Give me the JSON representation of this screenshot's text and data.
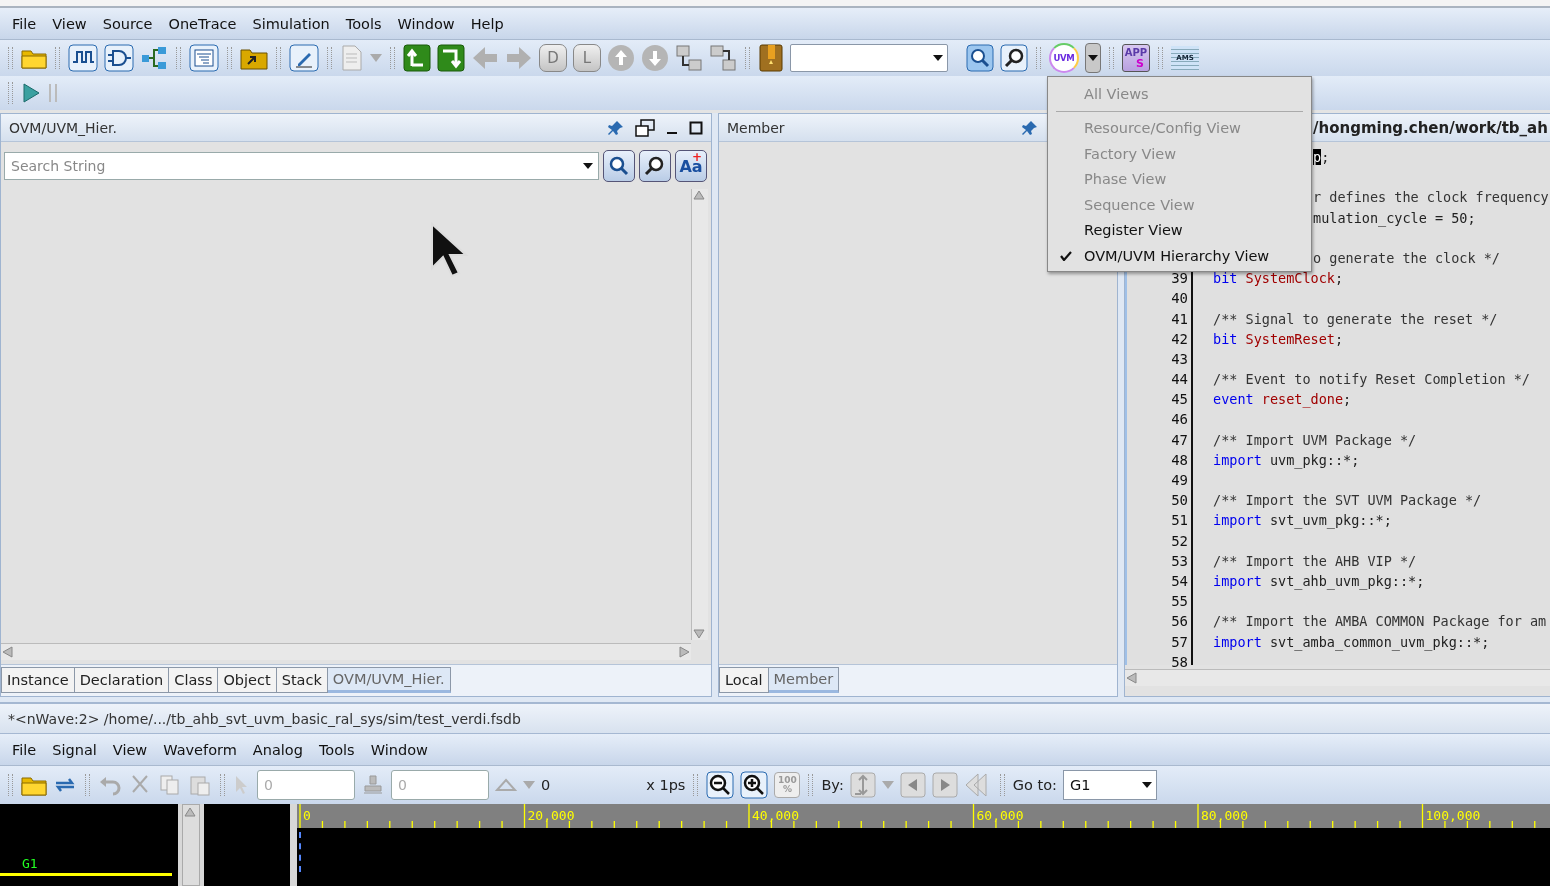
{
  "menubar": [
    {
      "label": "File"
    },
    {
      "label": "View"
    },
    {
      "label": "Source"
    },
    {
      "label": "OneTrace"
    },
    {
      "label": "Simulation"
    },
    {
      "label": "Tools"
    },
    {
      "label": "Window"
    },
    {
      "label": "Help"
    }
  ],
  "toolbar": {
    "letter_buttons": [
      "D",
      "L"
    ],
    "uvm_badge": "UVM",
    "apps_badge": [
      "APP",
      "S"
    ],
    "ams_badge": "AMS"
  },
  "view_menu": {
    "items": [
      {
        "kind": "item",
        "label": "All Views",
        "disabled": true,
        "checked": false
      },
      {
        "kind": "separator"
      },
      {
        "kind": "item",
        "label": "Resource/Config View",
        "disabled": true,
        "checked": false
      },
      {
        "kind": "item",
        "label": "Factory View",
        "disabled": true,
        "checked": false
      },
      {
        "kind": "item",
        "label": "Phase View",
        "disabled": true,
        "checked": false
      },
      {
        "kind": "item",
        "label": "Sequence View",
        "disabled": true,
        "checked": false
      },
      {
        "kind": "item",
        "label": "Register View",
        "disabled": false,
        "checked": false
      },
      {
        "kind": "item",
        "label": "OVM/UVM Hierarchy View",
        "disabled": false,
        "checked": true
      }
    ]
  },
  "hierarchy_pane": {
    "title": "OVM/UVM_Hier.",
    "search": {
      "placeholder": "Search String"
    },
    "case_button": {
      "label": "Aa",
      "badge": "+"
    },
    "tabs": [
      {
        "label": "Instance",
        "selected": false
      },
      {
        "label": "Declaration",
        "selected": false
      },
      {
        "label": "Class",
        "selected": false
      },
      {
        "label": "Object",
        "selected": false
      },
      {
        "label": "Stack",
        "selected": false
      },
      {
        "label": "OVM/UVM_Hier.",
        "selected": true
      }
    ]
  },
  "member_pane": {
    "title": "Member",
    "tabs": [
      {
        "label": "Local",
        "selected": false
      },
      {
        "label": "Member",
        "selected": true
      }
    ]
  },
  "source_pane": {
    "title": "/hongming.chen/work/tb_ah",
    "lines": [
      {
        "kind": "clipped",
        "segments": [
          {
            "kind": "selected",
            "text": "p"
          },
          {
            "kind": "plain",
            "text": ";"
          }
        ]
      },
      {
        "kind": "clipped"
      },
      {
        "kind": "clipped",
        "segments": [
          {
            "kind": "comment",
            "text": "r defines the clock frequency"
          }
        ]
      },
      {
        "kind": "clipped",
        "segments": [
          {
            "kind": "plain",
            "text": "mulation_cycle = 50;"
          }
        ]
      },
      {
        "kind": "clipped"
      },
      {
        "kind": "clipped",
        "segments": [
          {
            "kind": "comment",
            "text": "o generate the clock */"
          }
        ]
      },
      {
        "kind": "full",
        "number": "39",
        "segments": [
          {
            "kind": "keyword",
            "text": "bit"
          },
          {
            "kind": "ident",
            "text": "SystemClock",
            "spaced": true
          },
          {
            "kind": "plain",
            "text": ";"
          }
        ]
      },
      {
        "kind": "full",
        "number": "40"
      },
      {
        "kind": "full",
        "number": "41",
        "segments": [
          {
            "kind": "comment",
            "text": "/** Signal to generate the reset */"
          }
        ]
      },
      {
        "kind": "full",
        "number": "42",
        "segments": [
          {
            "kind": "keyword",
            "text": "bit"
          },
          {
            "kind": "ident",
            "text": "SystemReset",
            "spaced": true
          },
          {
            "kind": "plain",
            "text": ";"
          }
        ]
      },
      {
        "kind": "full",
        "number": "43"
      },
      {
        "kind": "full",
        "number": "44",
        "segments": [
          {
            "kind": "comment",
            "text": "/** Event to notify Reset Completion */"
          }
        ]
      },
      {
        "kind": "full",
        "number": "45",
        "segments": [
          {
            "kind": "keyword",
            "text": "event"
          },
          {
            "kind": "ident",
            "text": "reset_done",
            "spaced": true
          },
          {
            "kind": "plain",
            "text": ";"
          }
        ]
      },
      {
        "kind": "full",
        "number": "46"
      },
      {
        "kind": "full",
        "number": "47",
        "segments": [
          {
            "kind": "comment",
            "text": "/** Import UVM Package */"
          }
        ]
      },
      {
        "kind": "full",
        "number": "48",
        "segments": [
          {
            "kind": "keyword",
            "text": "import"
          },
          {
            "kind": "plain",
            "text": "uvm_pkg::*;",
            "spaced": true
          }
        ]
      },
      {
        "kind": "full",
        "number": "49"
      },
      {
        "kind": "full",
        "number": "50",
        "segments": [
          {
            "kind": "comment",
            "text": "/** Import the SVT UVM Package */"
          }
        ]
      },
      {
        "kind": "full",
        "number": "51",
        "segments": [
          {
            "kind": "keyword",
            "text": "import"
          },
          {
            "kind": "plain",
            "text": "svt_uvm_pkg::*;",
            "spaced": true
          }
        ]
      },
      {
        "kind": "full",
        "number": "52"
      },
      {
        "kind": "full",
        "number": "53",
        "segments": [
          {
            "kind": "comment",
            "text": "/** Import the AHB VIP */"
          }
        ]
      },
      {
        "kind": "full",
        "number": "54",
        "segments": [
          {
            "kind": "keyword",
            "text": "import"
          },
          {
            "kind": "plain",
            "text": "svt_ahb_uvm_pkg::*;",
            "spaced": true
          }
        ]
      },
      {
        "kind": "full",
        "number": "55"
      },
      {
        "kind": "full",
        "number": "56",
        "segments": [
          {
            "kind": "comment",
            "text": "/** Import the AMBA COMMON Package for am"
          }
        ]
      },
      {
        "kind": "full",
        "number": "57",
        "segments": [
          {
            "kind": "keyword",
            "text": "import"
          },
          {
            "kind": "plain",
            "text": "svt_amba_common_uvm_pkg::*;",
            "spaced": true
          }
        ]
      },
      {
        "kind": "full",
        "number": "58"
      }
    ]
  },
  "nwave": {
    "title": "*<nWave:2> /home/.../tb_ahb_svt_uvm_basic_ral_sys/sim/test_verdi.fsdb",
    "menubar": [
      {
        "label": "File"
      },
      {
        "label": "Signal"
      },
      {
        "label": "View"
      },
      {
        "label": "Waveform"
      },
      {
        "label": "Analog"
      },
      {
        "label": "Tools"
      },
      {
        "label": "Window"
      }
    ],
    "toolbar": {
      "cursor_time": "0",
      "marker_time": "0",
      "delta": "0",
      "unit": "x 1ps",
      "zoom_fit": [
        "100",
        "%"
      ],
      "by_label": "By:",
      "goto_label": "Go to:",
      "goto_value": "G1"
    },
    "signals": [
      {
        "name": "G1"
      }
    ],
    "ruler": [
      "0",
      "20,000",
      "40,000",
      "60,000",
      "80,000",
      "100,000"
    ]
  }
}
